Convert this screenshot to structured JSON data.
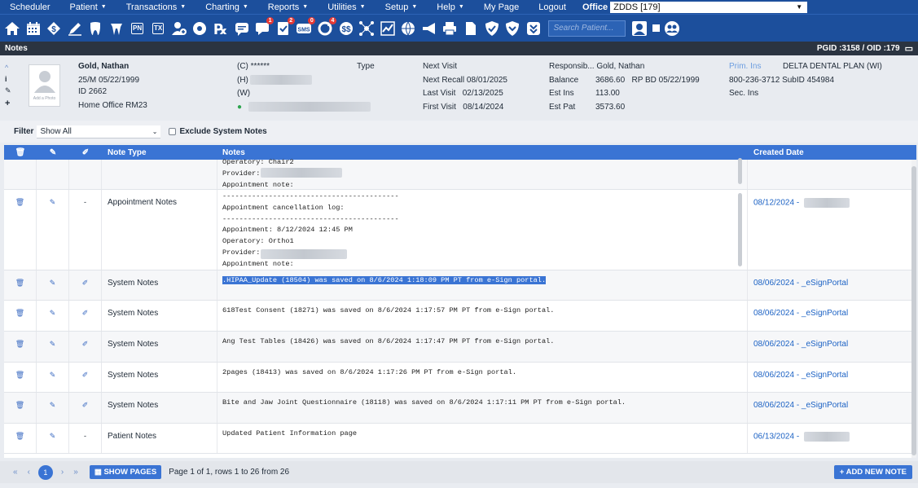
{
  "menu": {
    "items": [
      {
        "label": "Scheduler",
        "caret": false
      },
      {
        "label": "Patient",
        "caret": true
      },
      {
        "label": "Transactions",
        "caret": true
      },
      {
        "label": "Charting",
        "caret": true
      },
      {
        "label": "Reports",
        "caret": true
      },
      {
        "label": "Utilities",
        "caret": true
      },
      {
        "label": "Setup",
        "caret": true
      },
      {
        "label": "Help",
        "caret": true
      },
      {
        "label": "My Page",
        "caret": false
      },
      {
        "label": "Logout",
        "caret": false
      }
    ],
    "caret_glyph": "▼",
    "office_label": "Office",
    "office_value": "ZDDS [179]"
  },
  "toolbar": {
    "search_placeholder": "Search Patient...",
    "badges": {
      "chat": "1",
      "audit": "2",
      "sms": "0",
      "refresh": "4",
      "msg": "0"
    },
    "pn_label": "PN",
    "tx_label": "TX",
    "sms_label": "SMS",
    "rx_label": "℞"
  },
  "notes_bar": {
    "title": "Notes",
    "pgid": "PGID :3158 / OID :179"
  },
  "patient": {
    "name": "Gold, Nathan",
    "age_dob": "25/M  05/22/1999",
    "id": "ID 2662",
    "home_office": "Home Office  RM23",
    "add_photo": "Add a Photo",
    "phone_c": "(C) ******",
    "phone_h": "(H)",
    "phone_w": "(W)",
    "type_label": "Type",
    "next_visit_label": "Next Visit",
    "next_recall_label": "Next Recall",
    "next_recall": "08/01/2025",
    "last_visit_label": "Last Visit",
    "last_visit": "02/13/2025",
    "first_visit_label": "First Visit",
    "first_visit": "08/14/2024",
    "responsible_label": "Responsib...",
    "responsible": "Gold, Nathan",
    "balance_label": "Balance",
    "balance": "3686.60",
    "rp_bd": "RP BD  05/22/1999",
    "est_ins_label": "Est Ins",
    "est_ins": "113.00",
    "est_pat_label": "Est Pat",
    "est_pat": "3573.60",
    "prim_ins_label": "Prim. Ins",
    "prim_ins": "DELTA DENTAL PLAN (WI)",
    "ins_phone": "800-236-3712",
    "sub_id": "SubID 454984",
    "sec_ins_label": "Sec. Ins"
  },
  "filter": {
    "label": "Filter",
    "value": "Show All",
    "exclude_label": "Exclude System Notes"
  },
  "grid": {
    "headers": {
      "note_type": "Note Type",
      "notes": "Notes",
      "created": "Created Date"
    },
    "rows": [
      {
        "type": "",
        "dash": "",
        "notes": "Operatory: Chair2\nProvider: \nAppointment note:",
        "created": "",
        "clip": false,
        "tall": false,
        "partial": true
      },
      {
        "type": "Appointment Notes",
        "dash": "-",
        "notes": "------------------------------------------\nAppointment cancellation log:\n------------------------------------------\nAppointment: 8/12/2024 12:45 PM\nOperatory: Ortho1\nProvider: \nAppointment note:",
        "created": "08/12/2024 - ",
        "clip": false
      },
      {
        "type": "System Notes",
        "dash": "",
        "notes": ".HIPAA_Update (18504) was saved on 8/6/2024 1:18:09 PM PT from e-Sign portal.",
        "created": "08/06/2024 - _eSignPortal",
        "clip": true,
        "highlight": true
      },
      {
        "type": "System Notes",
        "dash": "",
        "notes": "618Test Consent (18271) was saved on 8/6/2024 1:17:57 PM PT from e-Sign portal.",
        "created": "08/06/2024 - _eSignPortal",
        "clip": true
      },
      {
        "type": "System Notes",
        "dash": "",
        "notes": "Ang Test Tables (18426) was saved on 8/6/2024 1:17:47 PM PT from e-Sign portal.",
        "created": "08/06/2024 - _eSignPortal",
        "clip": true
      },
      {
        "type": "System Notes",
        "dash": "",
        "notes": "2pages (18413) was saved on 8/6/2024 1:17:26 PM PT from e-Sign portal.",
        "created": "08/06/2024 - _eSignPortal",
        "clip": true
      },
      {
        "type": "System Notes",
        "dash": "",
        "notes": "Bite and Jaw Joint Questionnaire (18118) was saved on 8/6/2024 1:17:11 PM PT from e-Sign portal.",
        "created": "08/06/2024 - _eSignPortal",
        "clip": true
      },
      {
        "type": "Patient Notes",
        "dash": "-",
        "notes": "Updated Patient Information page",
        "created": "06/13/2024 - ",
        "clip": false
      }
    ]
  },
  "footer": {
    "first": "«",
    "prev": "‹",
    "page": "1",
    "next": "›",
    "last": "»",
    "show_pages": "SHOW PAGES",
    "page_info": "Page 1 of 1, rows 1 to 26 from 26",
    "add_note": "+ ADD NEW NOTE"
  },
  "colors": {
    "accent": "#1c4f9c",
    "header_blue": "#3a74d4",
    "link": "#1c62c4",
    "dark_bar": "#2b3441"
  }
}
